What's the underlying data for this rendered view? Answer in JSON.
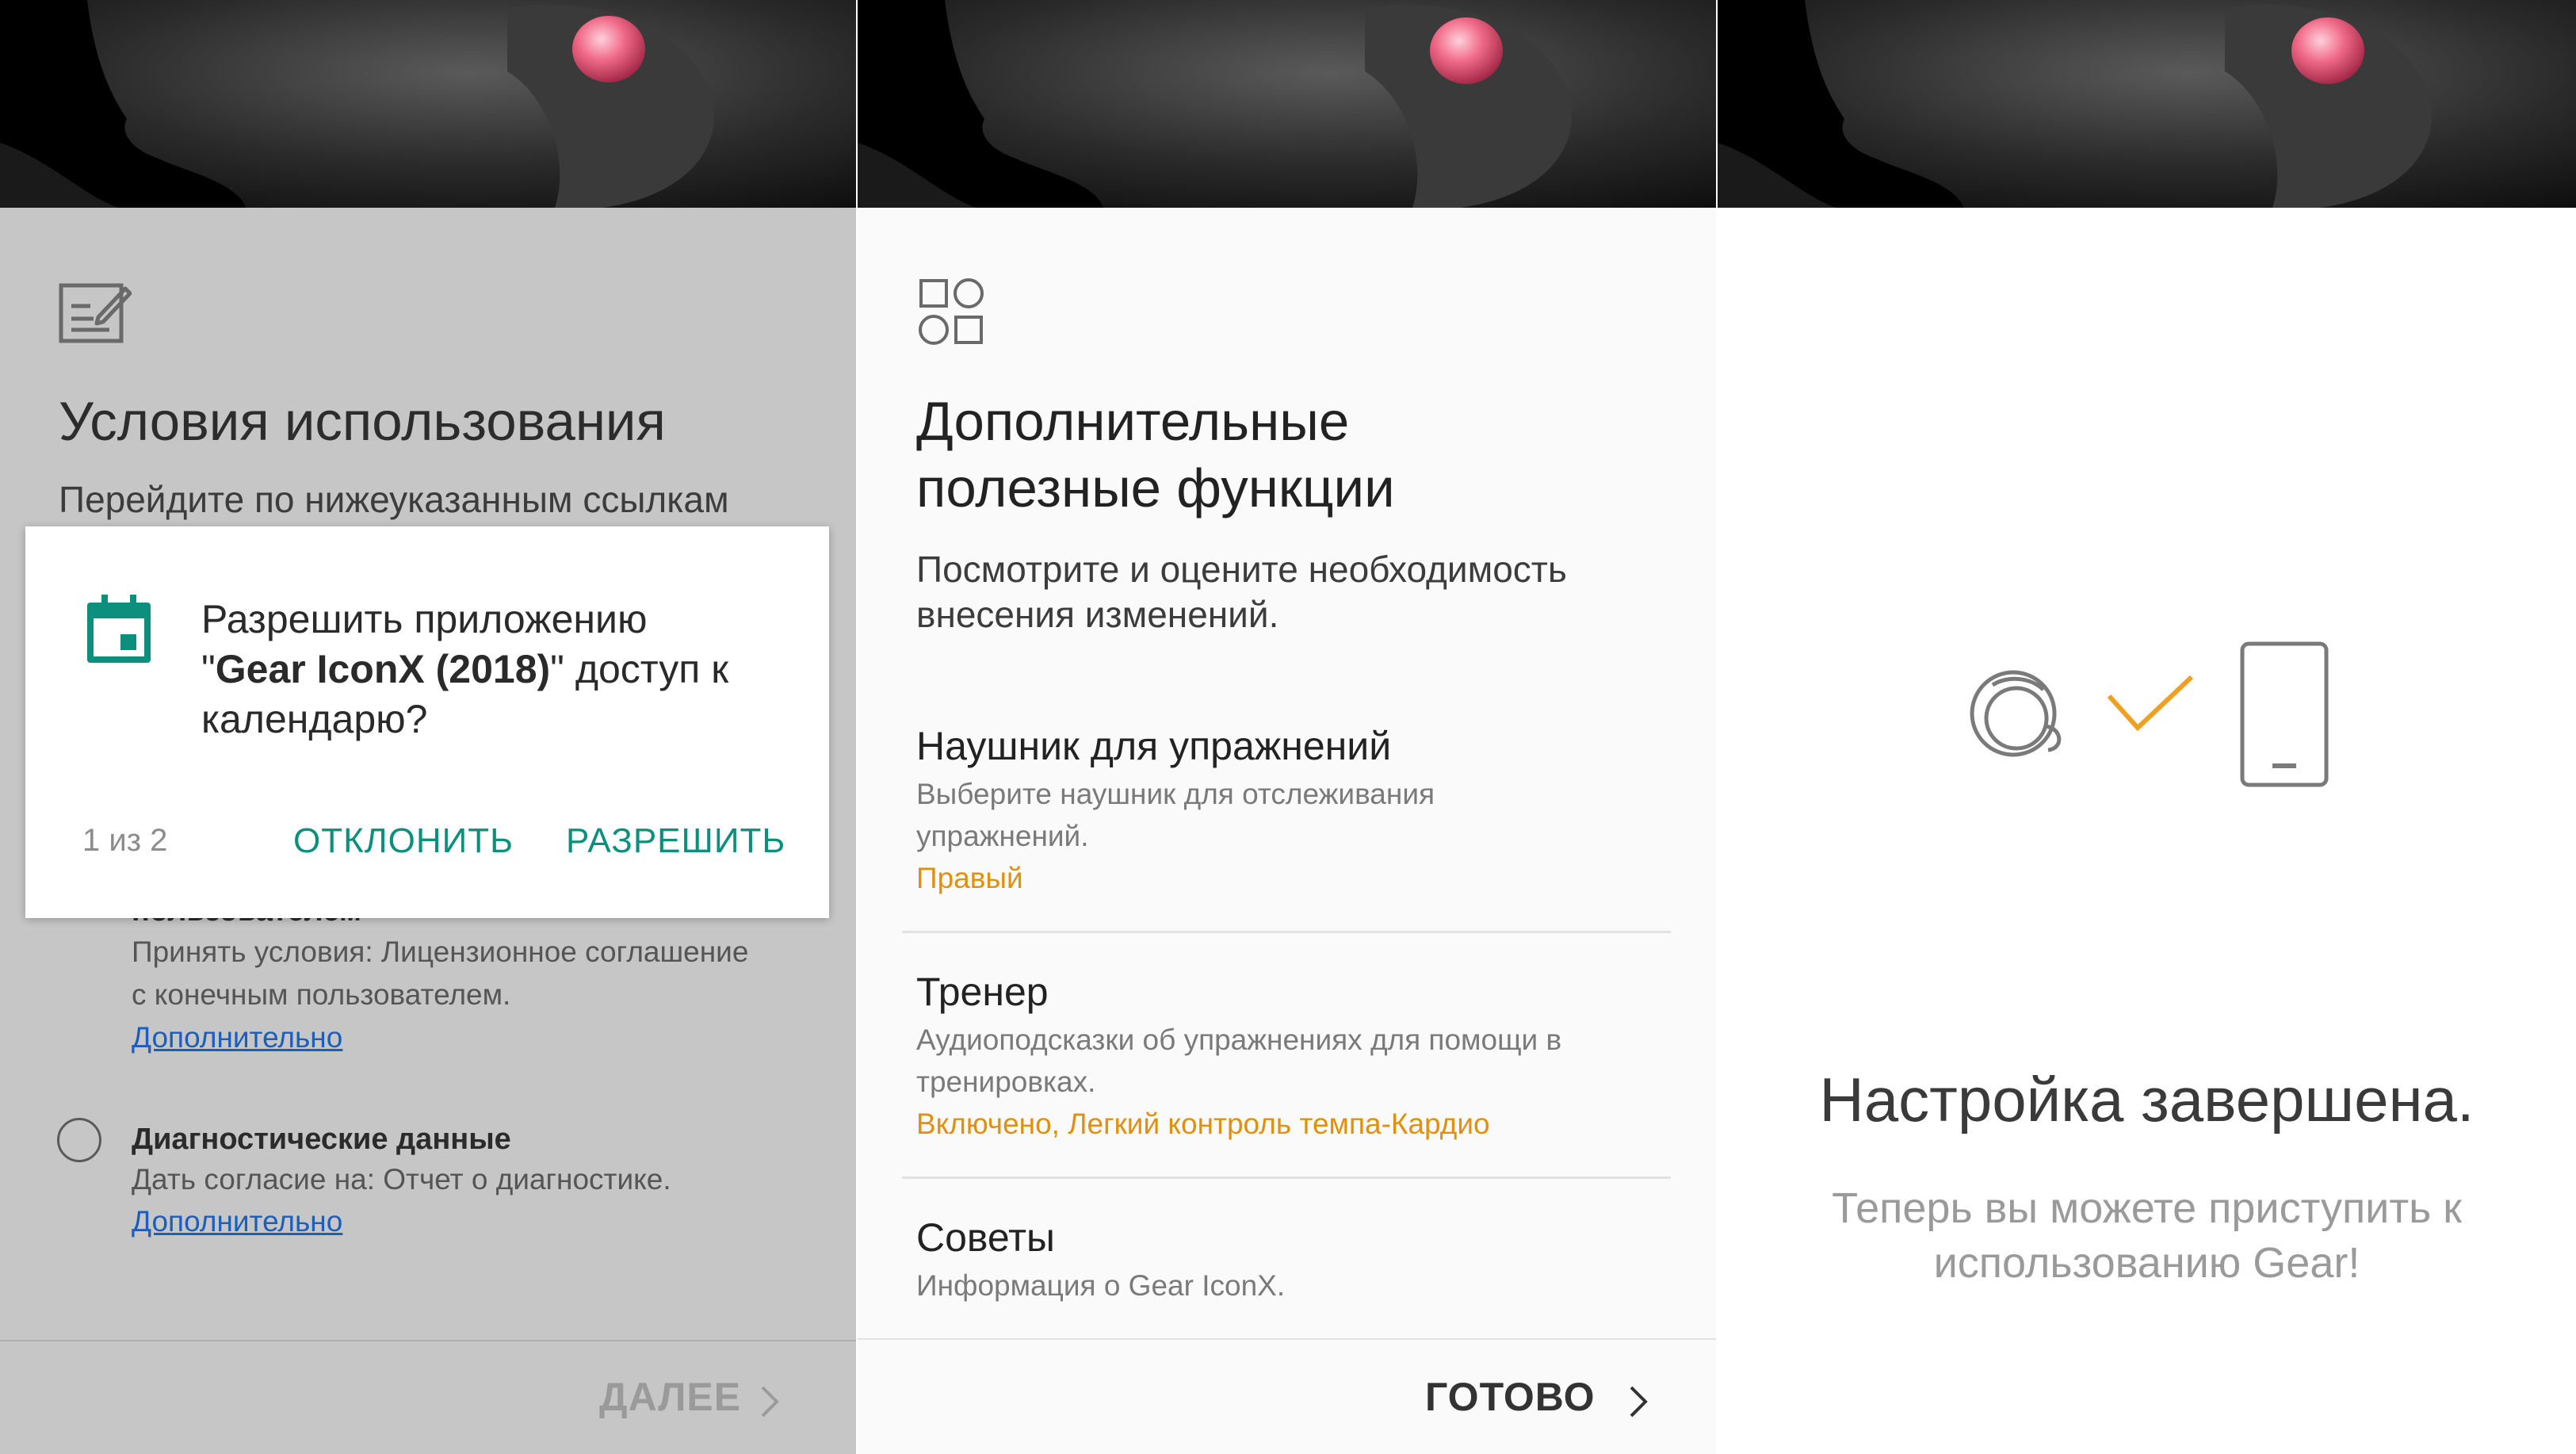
{
  "panel1": {
    "title": "Условия использования",
    "subtitle": "Перейдите по нижеуказанным ссылкам",
    "hidden_item_title": "пользователем",
    "eula_desc_line1": "Принять условия: Лицензионное соглашение",
    "eula_desc_line2": "с конечным пользователем.",
    "eula_link": "Дополнительно",
    "diag_title": "Диагностические данные",
    "diag_desc": "Дать согласие на: Отчет о диагностике.",
    "diag_link": "Дополнительно",
    "next_label": "ДАЛЕЕ",
    "icon": "edit-document-icon",
    "dialog": {
      "line1": "Разрешить приложению",
      "line2_quote_open": "\"",
      "line2_app": "Gear IconX (2018)",
      "line2_rest": "\" доступ к",
      "line3": "календарю?",
      "counter": "1 из 2",
      "deny_label": "ОТКЛОНИТЬ",
      "allow_label": "РАЗРЕШИТЬ",
      "icon": "calendar-icon",
      "accent": "#0d8f7d"
    }
  },
  "panel2": {
    "title_line1": "Дополнительные",
    "title_line2": "полезные функции",
    "subtitle_line1": "Посмотрите и оцените необходимость",
    "subtitle_line2": "внесения изменений.",
    "icon": "apps-grid-icon",
    "items": [
      {
        "title": "Наушник для упражнений",
        "desc_line1": "Выберите наушник для отслеживания",
        "desc_line2": "упражнений.",
        "value": "Правый"
      },
      {
        "title": "Тренер",
        "desc_line1": "Аудиоподсказки об упражнениях для помощи в",
        "desc_line2": "тренировках.",
        "value": "Включено, Легкий контроль темпа-Кардио"
      },
      {
        "title": "Советы",
        "desc_line1": "Информация о Gear IconX."
      }
    ],
    "done_label": "ГОТОВО",
    "value_color": "#e0900f"
  },
  "panel3": {
    "title": "Настройка завершена.",
    "subtitle": "Теперь вы можете приступить к использованию Gear!",
    "icons": [
      "earbud-icon",
      "checkmark-icon",
      "phone-icon"
    ],
    "check_color": "#f0a020"
  }
}
